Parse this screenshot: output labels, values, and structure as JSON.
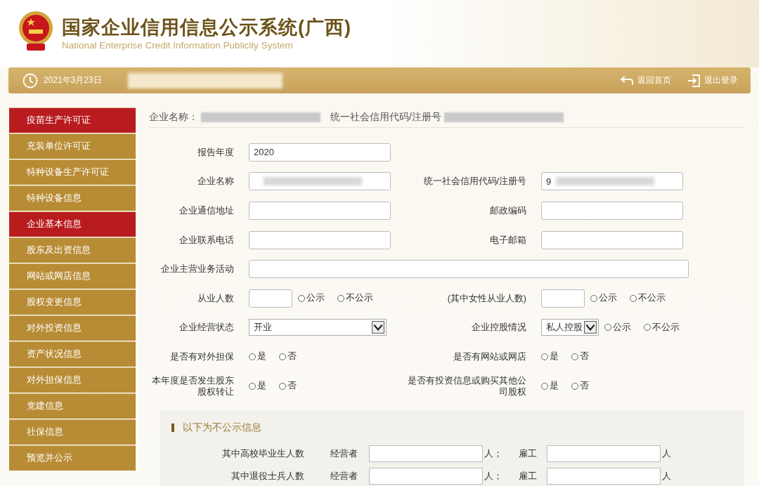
{
  "header": {
    "title": "国家企业信用信息公示系统(广西)",
    "subtitle": "National Enterprise Credit Information Publicity System"
  },
  "toolbar": {
    "date": "2021年3月23日",
    "redacted": true,
    "links": [
      {
        "kind": "home",
        "label": "返回首页"
      },
      {
        "kind": "logout",
        "label": "退出登录"
      }
    ]
  },
  "sidebar": {
    "items": [
      {
        "label": "疫苗生产许可证",
        "selected": true
      },
      {
        "label": "充装单位许可证",
        "selected": false
      },
      {
        "label": "特种设备生产许可证",
        "selected": false
      },
      {
        "label": "特种设备信息",
        "selected": false
      },
      {
        "label": "企业基本信息",
        "selected": true
      },
      {
        "label": "股东及出资信息",
        "selected": false
      },
      {
        "label": "网站或网店信息",
        "selected": false
      },
      {
        "label": "股权变更信息",
        "selected": false
      },
      {
        "label": "对外投资信息",
        "selected": false
      },
      {
        "label": "资产状况信息",
        "selected": false
      },
      {
        "label": "对外担保信息",
        "selected": false
      },
      {
        "label": "党建信息",
        "selected": false
      },
      {
        "label": "社保信息",
        "selected": false
      },
      {
        "label": "预览并公示",
        "selected": false
      }
    ]
  },
  "company_header": [
    {
      "label": "企业名称：",
      "redacted": true
    },
    {
      "label": "统一社会信用代码/注册号",
      "redacted": true
    }
  ],
  "form": {
    "rows": [
      {
        "left": {
          "kind": "text",
          "label": "报告年度",
          "value": "2020"
        }
      },
      {
        "left": {
          "kind": "text",
          "label": "企业名称",
          "redacted": true
        },
        "right": {
          "kind": "text",
          "label": "统一社会信用代码/注册号",
          "value": "9",
          "redacted": true
        }
      },
      {
        "left": {
          "kind": "text",
          "label": "企业通信地址"
        },
        "right": {
          "kind": "text",
          "label": "邮政编码"
        }
      },
      {
        "left": {
          "kind": "text",
          "label": "企业联系电话"
        },
        "right": {
          "kind": "text",
          "label": "电子邮箱"
        }
      },
      {
        "wide": true,
        "left": {
          "kind": "text",
          "label": "企业主营业务活动"
        }
      },
      {
        "left": {
          "kind": "count",
          "label": "从业人数",
          "options": [
            {
              "label": "公示",
              "selected": false
            },
            {
              "label": "不公示",
              "selected": false
            }
          ]
        },
        "right": {
          "kind": "count",
          "label": "(其中女性从业人数)",
          "options": [
            {
              "label": "公示",
              "selected": false
            },
            {
              "label": "不公示",
              "selected": false
            }
          ]
        }
      },
      {
        "left": {
          "kind": "select",
          "label": "企业经营状态",
          "value": "开业"
        },
        "right": {
          "kind": "select",
          "label": "企业控股情况",
          "value": "私人控股",
          "options": [
            {
              "label": "公示",
              "selected": false
            },
            {
              "label": "不公示",
              "selected": false
            }
          ]
        }
      },
      {
        "left": {
          "kind": "radio",
          "label": "是否有对外担保",
          "options": [
            {
              "label": "是",
              "selected": false
            },
            {
              "label": "否",
              "selected": false
            }
          ]
        },
        "right": {
          "kind": "radio",
          "label": "是否有网站或网店",
          "options": [
            {
              "label": "是",
              "selected": false
            },
            {
              "label": "否",
              "selected": false
            }
          ]
        }
      },
      {
        "left": {
          "kind": "radio",
          "label": "本年度是否发生股东股权转让",
          "options": [
            {
              "label": "是",
              "selected": false
            },
            {
              "label": "否",
              "selected": false
            }
          ]
        },
        "right": {
          "kind": "radio",
          "label": "是否有投资信息或购买其他公司股权",
          "options": [
            {
              "label": "是",
              "selected": false
            },
            {
              "label": "否",
              "selected": false
            }
          ]
        }
      }
    ]
  },
  "private_section": {
    "title": "以下为不公示信息",
    "rows": [
      {
        "label": "其中高校毕业生人数",
        "owner_label": "经营者",
        "owner_unit": "人；",
        "employee_label": "雇工",
        "employee_unit": "人"
      },
      {
        "label": "其中退役士兵人数",
        "owner_label": "经营者",
        "owner_unit": "人；",
        "employee_label": "雇工",
        "employee_unit": "人"
      }
    ]
  }
}
